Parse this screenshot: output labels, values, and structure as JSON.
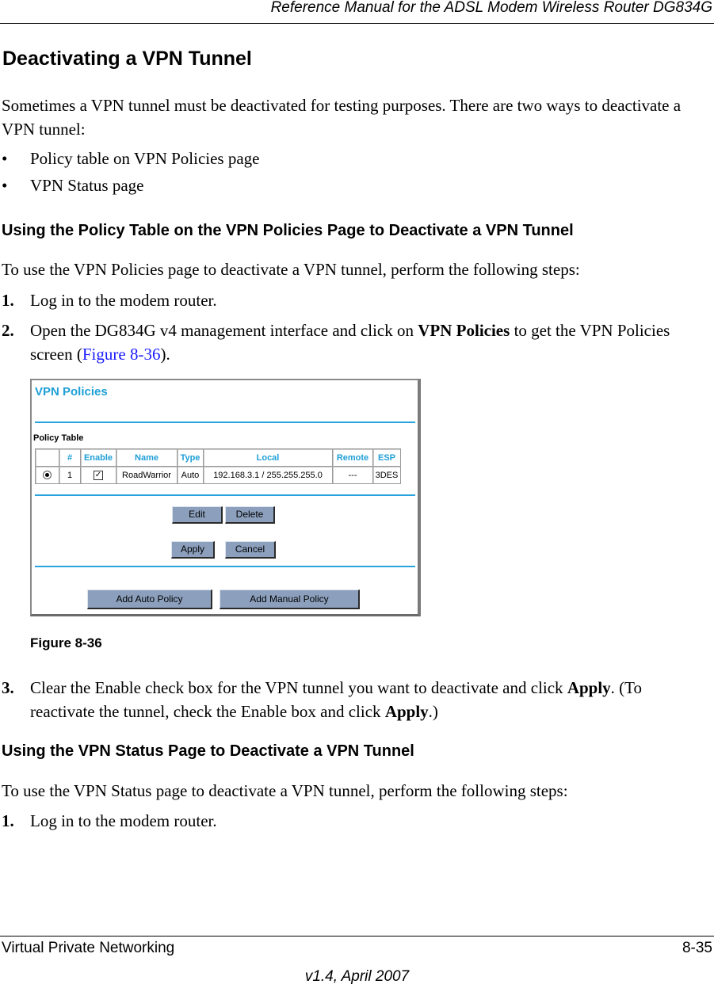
{
  "header": {
    "title": "Reference Manual for the ADSL Modem Wireless Router DG834G"
  },
  "section": {
    "title": "Deactivating a VPN Tunnel",
    "intro": "Sometimes a VPN tunnel must be deactivated for testing purposes. There are two ways to deactivate a VPN tunnel:",
    "bullets": [
      {
        "marker": "•",
        "text": "Policy table on VPN Policies page"
      },
      {
        "marker": "•",
        "text": "VPN Status page"
      }
    ]
  },
  "sub1": {
    "title": "Using the Policy Table on the VPN Policies Page to Deactivate a VPN Tunnel",
    "intro": "To use the VPN Policies page to deactivate a VPN tunnel, perform the following steps:",
    "steps": [
      {
        "num": "1.",
        "text": "Log in to the modem router."
      },
      {
        "num": "2.",
        "pre": "Open the DG834G v4 management interface and click on ",
        "bold": "VPN Policies",
        "mid": " to get the VPN Policies screen (",
        "link": "Figure 8-36",
        "post": ")."
      },
      {
        "num": "3.",
        "pre": "Clear the Enable check box for the VPN tunnel you want to deactivate and click ",
        "bold": "Apply",
        "mid": ". (To reactivate the tunnel, check the Enable box and click ",
        "bold2": "Apply",
        "post": ".)"
      }
    ]
  },
  "figure": {
    "caption": "Figure 8-36",
    "title": "VPN Policies",
    "table_title": "Policy Table",
    "columns": [
      "",
      "#",
      "Enable",
      "Name",
      "Type",
      "Local",
      "Remote",
      "ESP"
    ],
    "rows": [
      {
        "selected": true,
        "num": "1",
        "enabled": true,
        "name": "RoadWarrior",
        "type": "Auto",
        "local": "192.168.3.1 / 255.255.255.0",
        "remote": "---",
        "esp": "3DES"
      }
    ],
    "buttons": {
      "edit": "Edit",
      "delete": "Delete",
      "apply": "Apply",
      "cancel": "Cancel",
      "add_auto": "Add Auto Policy",
      "add_manual": "Add Manual Policy"
    },
    "accent_color": "#1e9fd6",
    "button_color": "#8ca0bd"
  },
  "sub2": {
    "title": "Using the VPN Status Page to Deactivate a VPN Tunnel",
    "intro": "To use the VPN Status page to deactivate a VPN tunnel, perform the following steps:",
    "steps": [
      {
        "num": "1.",
        "text": "Log in to the modem router."
      }
    ]
  },
  "footer": {
    "chapter": "Virtual Private Networking",
    "page": "8-35",
    "version": "v1.4, April 2007"
  }
}
